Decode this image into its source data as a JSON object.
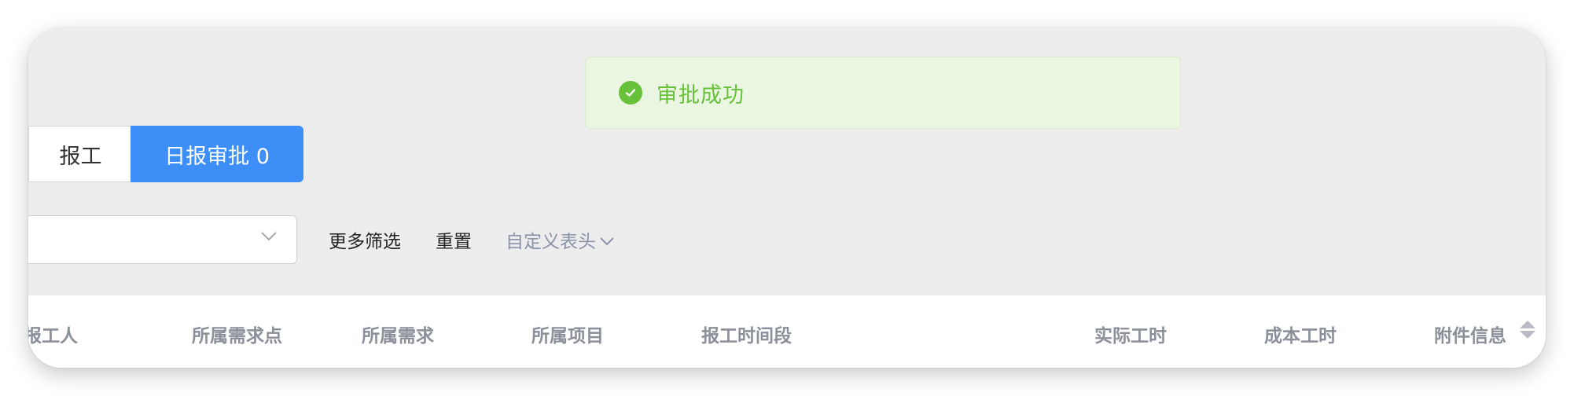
{
  "toast": {
    "message": "审批成功",
    "icon": "check-circle-icon",
    "color": "#67c23a"
  },
  "tabs": [
    {
      "label": "报工",
      "active": false
    },
    {
      "label": "日报审批 0",
      "active": true
    }
  ],
  "accent_color": "#3d8ff7",
  "filter": {
    "select_value": "",
    "more_filter_label": "更多筛选",
    "reset_label": "重置",
    "custom_header_label": "自定义表头"
  },
  "table": {
    "columns": [
      "报工人",
      "所属需求点",
      "所属需求",
      "所属项目",
      "报工时间段",
      "实际工时",
      "成本工时",
      "附件信息"
    ]
  }
}
